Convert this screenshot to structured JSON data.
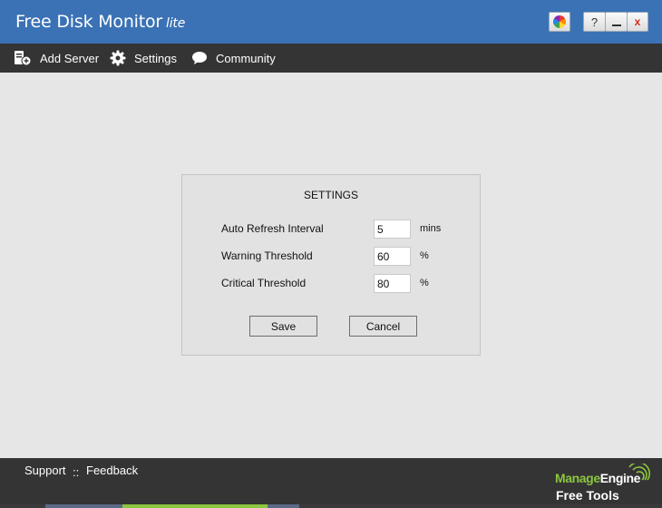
{
  "app": {
    "title": "Free Disk Monitor",
    "title_suffix": "lite",
    "help_label": "?",
    "close_label": "x"
  },
  "toolbar": {
    "add_server": "Add Server",
    "settings": "Settings",
    "community": "Community"
  },
  "dialog": {
    "title": "SETTINGS",
    "rows": [
      {
        "label": "Auto Refresh Interval",
        "value": "5",
        "unit": "mins"
      },
      {
        "label": "Warning Threshold",
        "value": "60",
        "unit": "%"
      },
      {
        "label": "Critical Threshold",
        "value": "80",
        "unit": "%"
      }
    ],
    "save_label": "Save",
    "cancel_label": "Cancel"
  },
  "footer": {
    "support": "Support",
    "separator": "::",
    "feedback": "Feedback",
    "brand_manage": "Manage",
    "brand_engine": "Engine",
    "brand_tools": "Free Tools"
  },
  "colors": {
    "titlebar": "#3b72b5",
    "toolbar": "#343434",
    "background": "#e6e6e6",
    "brand_green": "#8cc63f",
    "close_red": "#d12a1a"
  }
}
